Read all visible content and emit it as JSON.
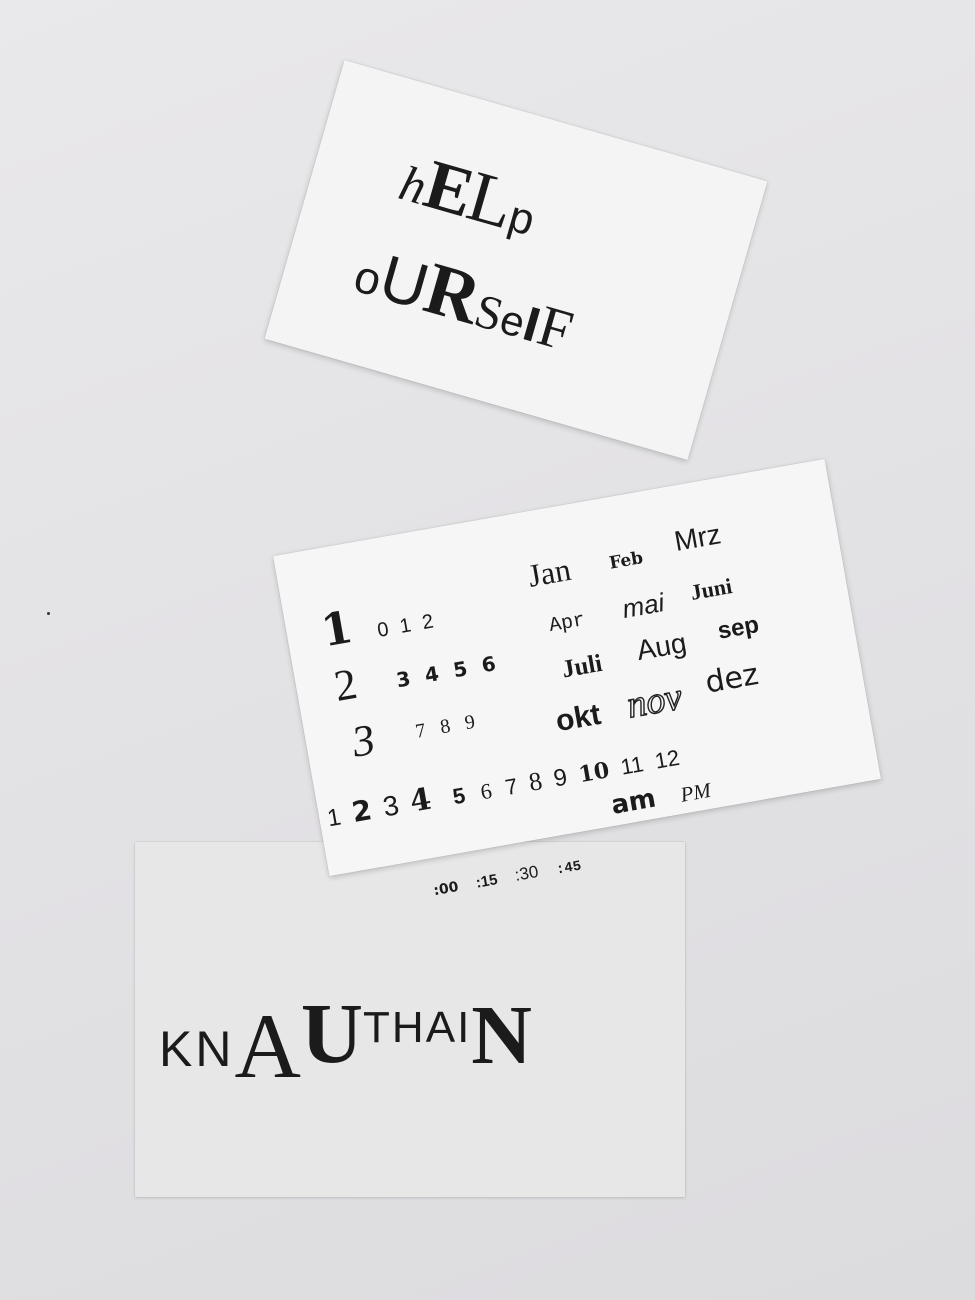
{
  "cards": {
    "help": {
      "line1": "hELp",
      "line2": "oURSelF"
    },
    "calendar": {
      "big_digits": [
        "1",
        "2",
        "3"
      ],
      "row_012": "0 1 2",
      "row_3456": "3 4 5 6",
      "row_789": "7 8 9",
      "months": [
        "Jan",
        "Feb",
        "Mrz",
        "Apr",
        "mai",
        "Juni",
        "Juli",
        "Aug",
        "sep",
        "okt",
        "nov",
        "dez"
      ],
      "numbers": [
        "1",
        "2",
        "3",
        "4",
        "5",
        "6",
        "7",
        "8",
        "9",
        "10",
        "11",
        "12"
      ],
      "am": "am",
      "pm": "PM",
      "minutes": [
        ":00",
        ":15",
        ":30",
        ":45"
      ]
    },
    "knauthain": {
      "letters": [
        "K",
        "N",
        "A",
        "U",
        "T",
        "H",
        "A",
        "I",
        "N"
      ]
    }
  }
}
